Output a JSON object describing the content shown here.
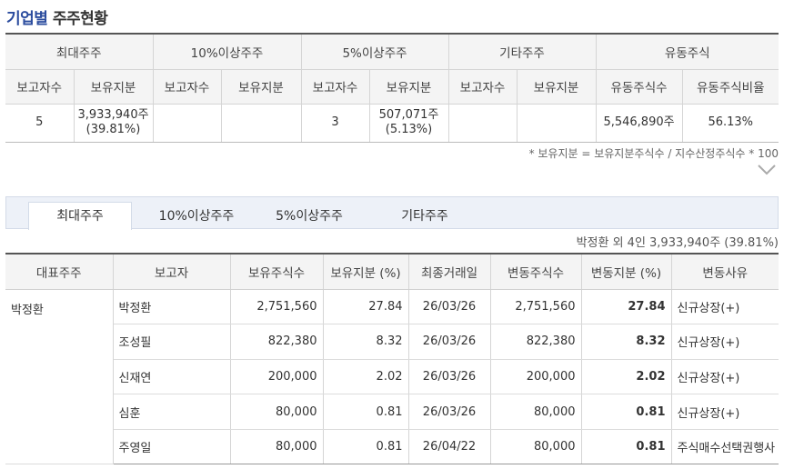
{
  "title": {
    "highlight": "기업별",
    "rest": "주주현황"
  },
  "summary": {
    "groups": [
      "최대주주",
      "10%이상주주",
      "5%이상주주",
      "기타주주",
      "유동주식"
    ],
    "subheaders": [
      "보고자수",
      "보유지분",
      "보고자수",
      "보유지분",
      "보고자수",
      "보유지분",
      "보고자수",
      "보유지분",
      "유동주식수",
      "유동주식비율"
    ],
    "row": [
      {
        "l1": "5",
        "l2": ""
      },
      {
        "l1": "3,933,940주",
        "l2": "(39.81%)"
      },
      {
        "l1": "",
        "l2": ""
      },
      {
        "l1": "",
        "l2": ""
      },
      {
        "l1": "3",
        "l2": ""
      },
      {
        "l1": "507,071주",
        "l2": "(5.13%)"
      },
      {
        "l1": "",
        "l2": ""
      },
      {
        "l1": "",
        "l2": ""
      },
      {
        "l1": "5,546,890주",
        "l2": ""
      },
      {
        "l1": "56.13%",
        "l2": ""
      }
    ],
    "note": "* 보유지분 = 보유지분주식수 / 지수산정주식수 * 100"
  },
  "tabs": [
    "최대주주",
    "10%이상주주",
    "5%이상주주",
    "기타주주"
  ],
  "active_tab": 0,
  "detail": {
    "total": "박정환 외 4인 3,933,940주 (39.81%)",
    "headers": [
      "대표주주",
      "보고자",
      "보유주식수",
      "보유지분 (%)",
      "최종거래일",
      "변동주식수",
      "변동지분 (%)",
      "변동사유"
    ],
    "representative": "박정환",
    "rows": [
      {
        "reporter": "박정환",
        "shares": "2,751,560",
        "stake": "27.84",
        "last_date": "26/03/26",
        "change_shares": "2,751,560",
        "change_stake": "27.84",
        "reason": "신규상장(+)"
      },
      {
        "reporter": "조성필",
        "shares": "822,380",
        "stake": "8.32",
        "last_date": "26/03/26",
        "change_shares": "822,380",
        "change_stake": "8.32",
        "reason": "신규상장(+)"
      },
      {
        "reporter": "신재연",
        "shares": "200,000",
        "stake": "2.02",
        "last_date": "26/03/26",
        "change_shares": "200,000",
        "change_stake": "2.02",
        "reason": "신규상장(+)"
      },
      {
        "reporter": "심훈",
        "shares": "80,000",
        "stake": "0.81",
        "last_date": "26/03/26",
        "change_shares": "80,000",
        "change_stake": "0.81",
        "reason": "신규상장(+)"
      },
      {
        "reporter": "주영일",
        "shares": "80,000",
        "stake": "0.81",
        "last_date": "26/04/22",
        "change_shares": "80,000",
        "change_stake": "0.81",
        "reason": "주식매수선택권행사"
      }
    ]
  },
  "icons": {
    "collapse": "chevron-down-icon"
  },
  "colors": {
    "title_accent": "#2b4c9e",
    "tab_bar": "#edf1f8",
    "header_bg": "#f4f4f4"
  }
}
